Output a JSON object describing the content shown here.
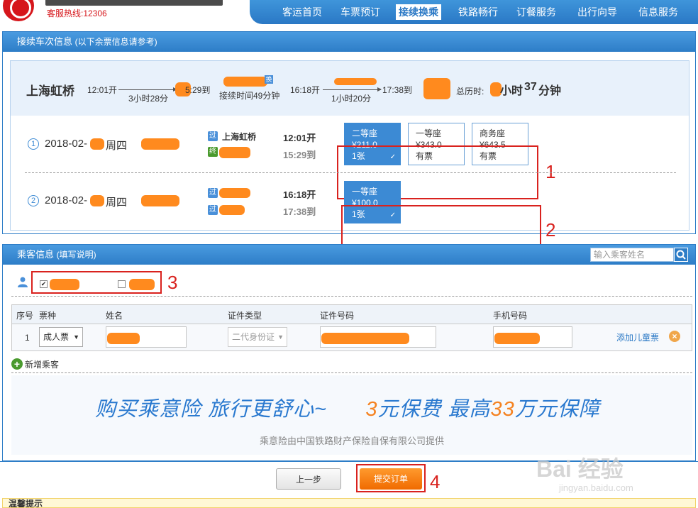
{
  "header": {
    "hotline": "客服热线:12306",
    "nav": [
      "客运首页",
      "车票预订",
      "接续换乘",
      "铁路畅行",
      "订餐服务",
      "出行向导",
      "信息服务"
    ],
    "nav_active": "接续换乘"
  },
  "trip": {
    "panel_title": "接续车次信息",
    "panel_subtitle": "(以下余票信息请参考)",
    "summary": {
      "origin": "上海虹桥",
      "dep1": "12:01开",
      "duration1": "3小时28分",
      "arr1": "5:29到",
      "transfer": "接续时间49分钟",
      "dep2": "16:18开",
      "duration2": "1小时20分",
      "arr2": "17:38到",
      "total_label": "总历时:",
      "total_value": "小时",
      "total_min": "37",
      "total_unit": "分钟"
    },
    "rows": [
      {
        "index": "1",
        "date": "2018-02-",
        "weekday": "周四",
        "from_tag": "过",
        "from": "上海虹桥",
        "to_tag": "终",
        "dep": "12:01开",
        "arr": "15:29到",
        "seats": [
          {
            "l1": "二等座",
            "l2": "¥211.0",
            "l3": "1张",
            "selected": true
          },
          {
            "l1": "一等座",
            "l2": "¥343.0",
            "l3": "有票",
            "selected": false
          },
          {
            "l1": "商务座",
            "l2": "¥643.5",
            "l3": "有票",
            "selected": false
          }
        ]
      },
      {
        "index": "2",
        "date": "2018-02-",
        "weekday": "周四",
        "from_tag": "过",
        "to_tag": "过",
        "dep": "16:18开",
        "arr": "17:38到",
        "seats": [
          {
            "l1": "一等座",
            "l2": "¥100.0",
            "l3": "1张",
            "selected": true
          }
        ]
      }
    ]
  },
  "passenger": {
    "panel_title": "乘客信息",
    "panel_subtitle": "(填写说明)",
    "search_placeholder": "输入乘客姓名",
    "table_headers": [
      "序号",
      "票种",
      "姓名",
      "证件类型",
      "证件号码",
      "手机号码"
    ],
    "row": {
      "index": "1",
      "ticket_type": "成人票",
      "id_type": "二代身份证",
      "add_child": "添加儿童票"
    },
    "add_passenger": "新增乘客"
  },
  "insurance": {
    "slogan_a": "购买乘意险  旅行更舒心~",
    "slogan_b_num": "3",
    "slogan_b_txt": "元保费  最高",
    "slogan_c_num": "33",
    "slogan_c_txt": "万元保障",
    "note": "乘意险由中国铁路财产保险自保有限公司提供"
  },
  "actions": {
    "prev": "上一步",
    "submit": "提交订单"
  },
  "tip": "温馨提示",
  "annotations": [
    "1",
    "2",
    "3",
    "4"
  ],
  "watermark": {
    "brand": "Bai  经验",
    "url": "jingyan.baidu.com"
  },
  "colors": {
    "brand_red": "#d6161b",
    "primary_blue": "#2d7dc7",
    "submit_orange": "#f06b00",
    "annotation_red": "#d9221e"
  }
}
